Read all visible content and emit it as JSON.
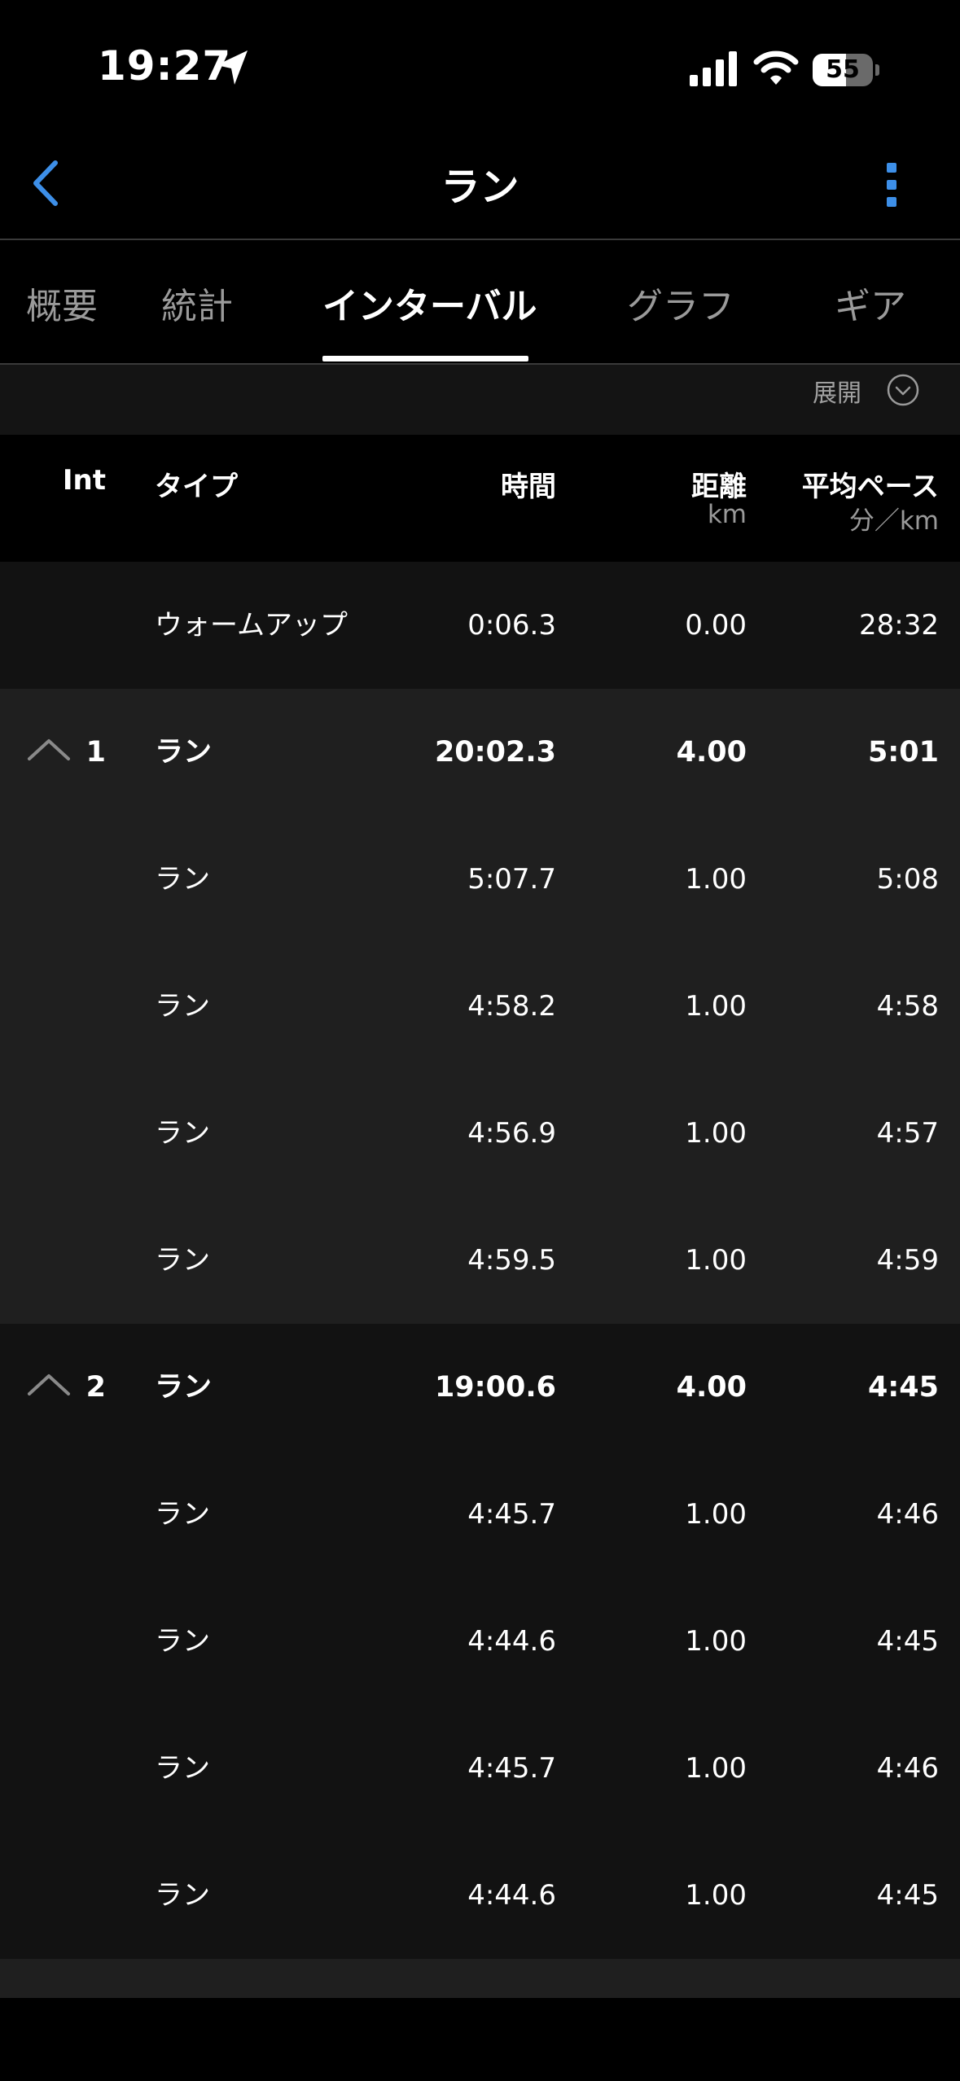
{
  "status_bar": {
    "time": "19:27",
    "battery": "55"
  },
  "nav": {
    "title": "ラン"
  },
  "tabs": [
    {
      "label": "概要"
    },
    {
      "label": "統計"
    },
    {
      "label": "インターバル"
    },
    {
      "label": "グラフ"
    },
    {
      "label": "ギア"
    }
  ],
  "expand": {
    "label": "展開"
  },
  "columns": {
    "int": "Int",
    "type": "タイプ",
    "time": "時間",
    "distance": "距離",
    "distance_unit": "km",
    "pace": "平均ペース",
    "pace_unit": "分／km"
  },
  "rows": [
    {
      "int": "",
      "type": "ウォームアップ",
      "time": "0:06.3",
      "distance": "0.00",
      "pace": "28:32"
    },
    {
      "int": "1",
      "type": "ラン",
      "time": "20:02.3",
      "distance": "4.00",
      "pace": "5:01"
    },
    {
      "int": "",
      "type": "ラン",
      "time": "5:07.7",
      "distance": "1.00",
      "pace": "5:08"
    },
    {
      "int": "",
      "type": "ラン",
      "time": "4:58.2",
      "distance": "1.00",
      "pace": "4:58"
    },
    {
      "int": "",
      "type": "ラン",
      "time": "4:56.9",
      "distance": "1.00",
      "pace": "4:57"
    },
    {
      "int": "",
      "type": "ラン",
      "time": "4:59.5",
      "distance": "1.00",
      "pace": "4:59"
    },
    {
      "int": "2",
      "type": "ラン",
      "time": "19:00.6",
      "distance": "4.00",
      "pace": "4:45"
    },
    {
      "int": "",
      "type": "ラン",
      "time": "4:45.7",
      "distance": "1.00",
      "pace": "4:46"
    },
    {
      "int": "",
      "type": "ラン",
      "time": "4:44.6",
      "distance": "1.00",
      "pace": "4:45"
    },
    {
      "int": "",
      "type": "ラン",
      "time": "4:45.7",
      "distance": "1.00",
      "pace": "4:46"
    },
    {
      "int": "",
      "type": "ラン",
      "time": "4:44.6",
      "distance": "1.00",
      "pace": "4:45"
    }
  ],
  "colors": {
    "accent": "#3d8fe8",
    "background": "#000000",
    "row_dark": "#121212",
    "row_light": "#1f1f1f"
  }
}
